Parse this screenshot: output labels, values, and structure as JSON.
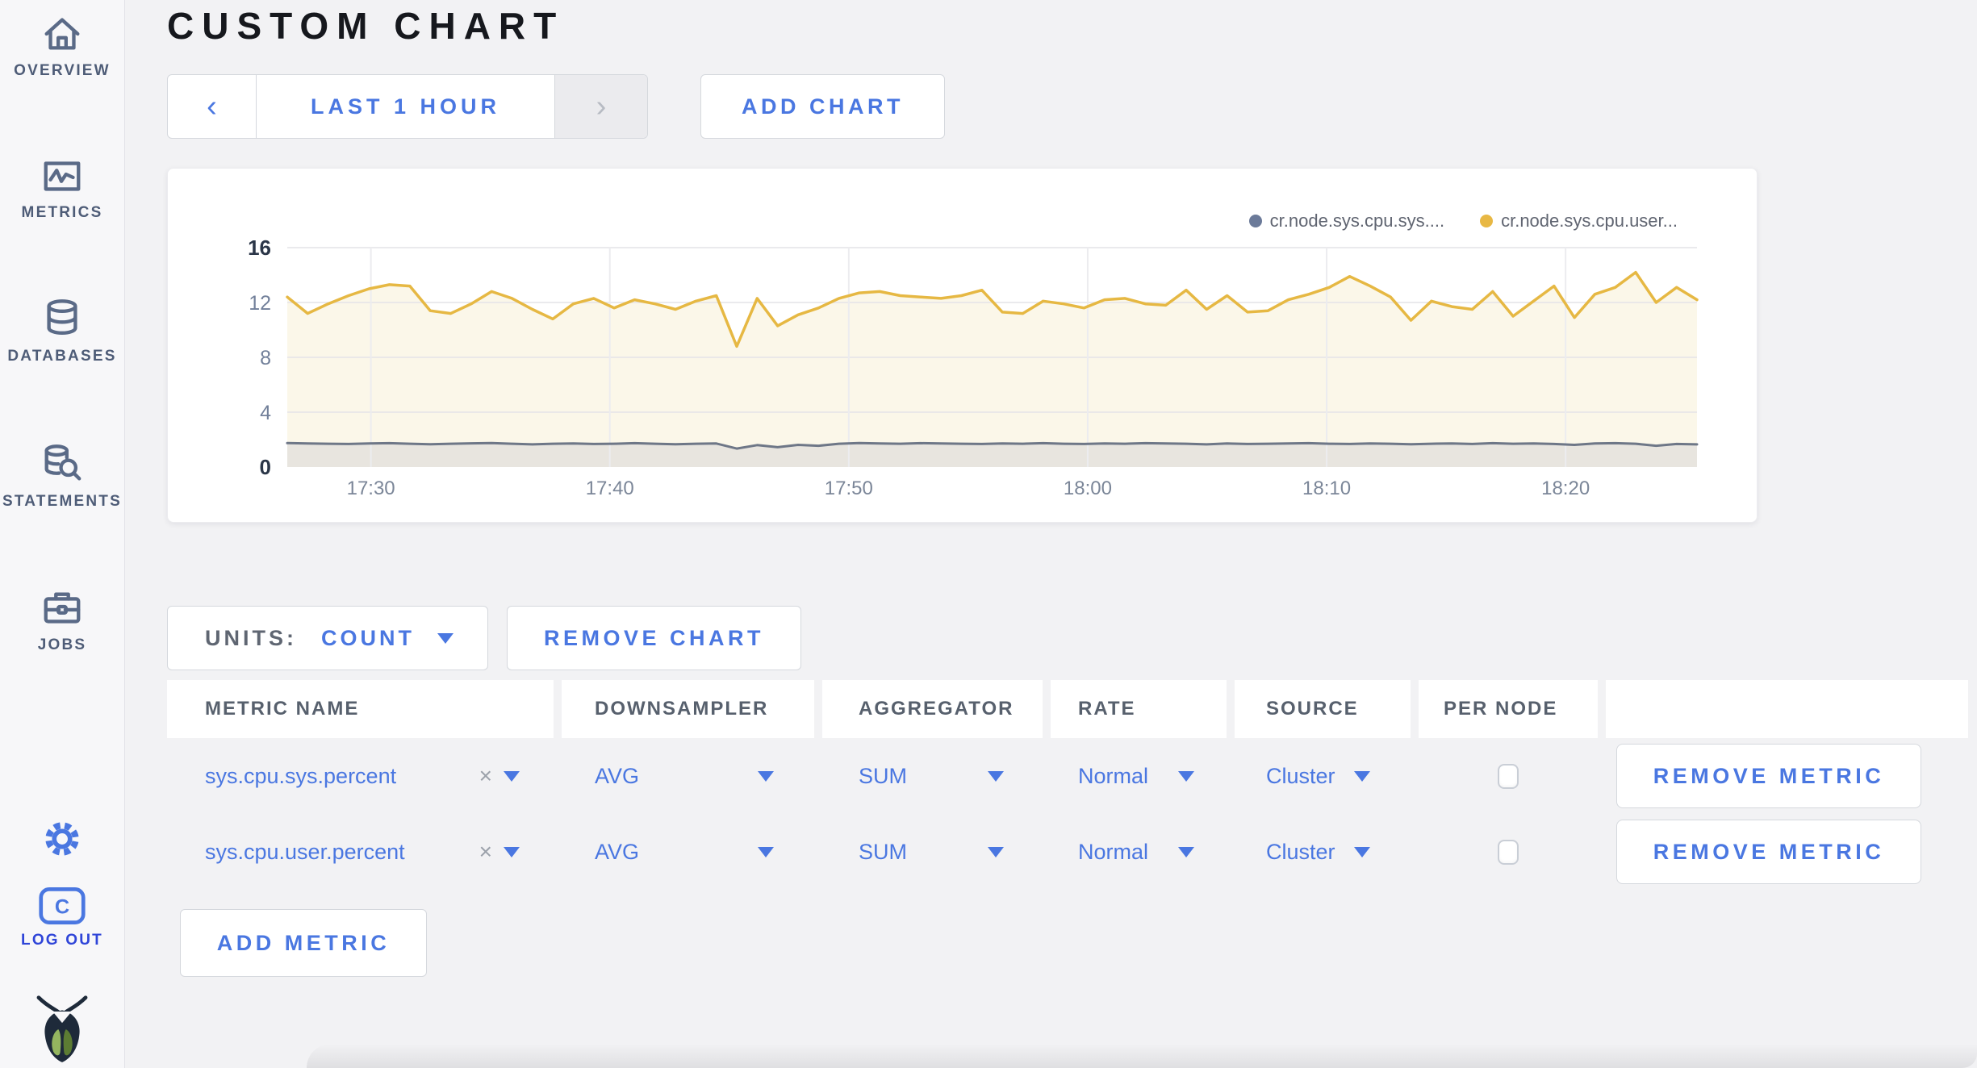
{
  "sidebar": {
    "items": [
      {
        "label": "OVERVIEW"
      },
      {
        "label": "METRICS"
      },
      {
        "label": "DATABASES"
      },
      {
        "label": "STATEMENTS"
      },
      {
        "label": "JOBS"
      }
    ],
    "logout_label": "LOG OUT",
    "logout_logo_letter": "C"
  },
  "header": {
    "title": "CUSTOM CHART"
  },
  "controls": {
    "chevron_left": "‹",
    "chevron_right": "›",
    "time_range": "LAST 1 HOUR",
    "add_chart": "ADD CHART"
  },
  "chart_data": {
    "type": "area",
    "title": "",
    "xlabel": "",
    "ylabel": "",
    "ylim": [
      0,
      16
    ],
    "yticks": [
      0,
      4,
      8,
      12,
      16
    ],
    "grid": true,
    "legend_position": "top-right",
    "x_domain_minutes": [
      0,
      59
    ],
    "x_ticks": [
      {
        "t": 3.5,
        "label": "17:30"
      },
      {
        "t": 13.5,
        "label": "17:40"
      },
      {
        "t": 23.5,
        "label": "17:50"
      },
      {
        "t": 33.5,
        "label": "18:00"
      },
      {
        "t": 43.5,
        "label": "18:10"
      },
      {
        "t": 53.5,
        "label": "18:20"
      }
    ],
    "series": [
      {
        "name": "cr.node.sys.cpu.sys....",
        "metric": "sys.cpu.sys.percent",
        "color": "#6b7a99",
        "line_color": "#6e7787",
        "fill": "#e8e5df",
        "values": [
          1.75,
          1.72,
          1.7,
          1.68,
          1.72,
          1.74,
          1.7,
          1.66,
          1.7,
          1.73,
          1.75,
          1.7,
          1.65,
          1.7,
          1.72,
          1.68,
          1.7,
          1.74,
          1.7,
          1.66,
          1.7,
          1.72,
          1.35,
          1.6,
          1.45,
          1.62,
          1.55,
          1.7,
          1.75,
          1.72,
          1.7,
          1.74,
          1.72,
          1.7,
          1.68,
          1.72,
          1.7,
          1.74,
          1.7,
          1.68,
          1.72,
          1.7,
          1.74,
          1.72,
          1.7,
          1.65,
          1.72,
          1.68,
          1.7,
          1.72,
          1.74,
          1.7,
          1.68,
          1.72,
          1.7,
          1.66,
          1.7,
          1.72,
          1.68,
          1.74,
          1.7,
          1.72,
          1.68,
          1.62,
          1.72,
          1.74,
          1.7,
          1.55,
          1.68,
          1.65
        ]
      },
      {
        "name": "cr.node.sys.cpu.user...",
        "metric": "sys.cpu.user.percent",
        "color": "#e8b844",
        "line_color": "#e6b843",
        "fill": "#fbf7e9",
        "values": [
          12.4,
          11.2,
          11.9,
          12.5,
          13.0,
          13.3,
          13.2,
          11.4,
          11.2,
          11.9,
          12.8,
          12.3,
          11.5,
          10.8,
          11.9,
          12.3,
          11.6,
          12.2,
          11.9,
          11.5,
          12.1,
          12.5,
          8.8,
          12.3,
          10.3,
          11.1,
          11.6,
          12.3,
          12.7,
          12.8,
          12.5,
          12.4,
          12.3,
          12.5,
          12.9,
          11.3,
          11.2,
          12.1,
          11.9,
          11.6,
          12.2,
          12.3,
          11.9,
          11.8,
          12.9,
          11.5,
          12.5,
          11.3,
          11.4,
          12.2,
          12.6,
          13.1,
          13.9,
          13.2,
          12.4,
          10.7,
          12.1,
          11.7,
          11.5,
          12.8,
          11.0,
          12.1,
          13.2,
          10.9,
          12.6,
          13.1,
          14.2,
          12.0,
          13.1,
          12.2
        ]
      }
    ]
  },
  "chart_controls": {
    "units_label": "UNITS:",
    "units_value": "COUNT",
    "remove_chart": "REMOVE CHART"
  },
  "metrics_table": {
    "columns": [
      "METRIC NAME",
      "DOWNSAMPLER",
      "AGGREGATOR",
      "RATE",
      "SOURCE",
      "PER NODE",
      ""
    ],
    "clear_icon": "×",
    "rows": [
      {
        "name": "sys.cpu.sys.percent",
        "downsampler": "AVG",
        "aggregator": "SUM",
        "rate": "Normal",
        "source": "Cluster",
        "per_node": false,
        "remove_label": "REMOVE METRIC"
      },
      {
        "name": "sys.cpu.user.percent",
        "downsampler": "AVG",
        "aggregator": "SUM",
        "rate": "Normal",
        "source": "Cluster",
        "per_node": false,
        "remove_label": "REMOVE METRIC"
      }
    ],
    "add_metric": "ADD METRIC"
  }
}
